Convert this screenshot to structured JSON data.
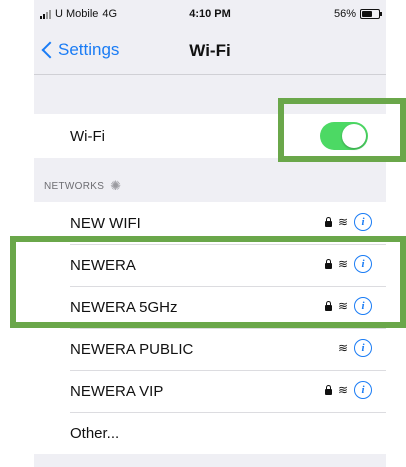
{
  "status_bar": {
    "carrier": "U Mobile",
    "network": "4G",
    "time": "4:10 PM",
    "battery_percent": "56%",
    "battery_level": 0.56
  },
  "nav": {
    "back_label": "Settings",
    "title": "Wi-Fi"
  },
  "wifi_toggle": {
    "label": "Wi-Fi",
    "state": "on",
    "color": "#4cd964"
  },
  "networks_header": "NETWORKS",
  "networks": [
    {
      "name": "NEW WIFI",
      "locked": true
    },
    {
      "name": "NEWERA",
      "locked": true
    },
    {
      "name": "NEWERA 5GHz",
      "locked": true
    },
    {
      "name": "NEWERA PUBLIC",
      "locked": false
    },
    {
      "name": "NEWERA VIP",
      "locked": true
    }
  ],
  "other_label": "Other...",
  "colors": {
    "accent": "#1a7cf5",
    "highlight": "#6aa74a"
  }
}
